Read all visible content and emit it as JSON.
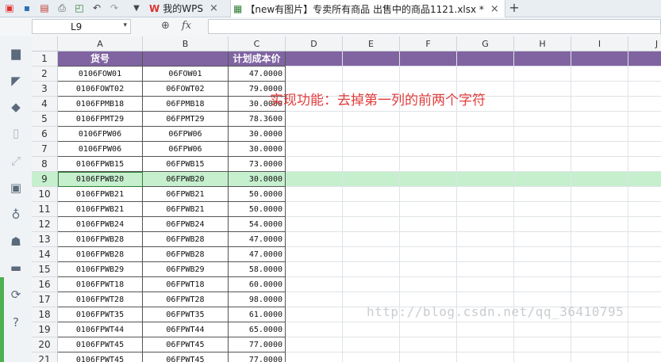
{
  "tabs": [
    {
      "label": "我的WPS",
      "close": "×"
    },
    {
      "label": "【new有图片】专卖所有商品 出售中的商品1121.xlsx *",
      "close": "×"
    }
  ],
  "new_tab": "+",
  "toolbar_icons": [
    "wps-logo-icon",
    "save-icon",
    "print-preview-icon",
    "print-icon",
    "preview-icon",
    "undo-icon",
    "redo-icon",
    "dropdown-icon"
  ],
  "namebox": {
    "value": "L9",
    "arrow": "▾"
  },
  "formula_bar": {
    "zoom_icon": "⊕",
    "fx": "fx",
    "value": ""
  },
  "columns": [
    "A",
    "B",
    "C",
    "D",
    "E",
    "F",
    "G",
    "H",
    "I",
    "J"
  ],
  "header_row": {
    "a": "货号",
    "b": "",
    "c": "计划成本价"
  },
  "rows": [
    {
      "n": "2",
      "a": "0106FOW01",
      "b": "06FOW01",
      "c": "47.0000"
    },
    {
      "n": "3",
      "a": "0106FOWT02",
      "b": "06FOWT02",
      "c": "79.0000"
    },
    {
      "n": "4",
      "a": "0106FPMB18",
      "b": "06FPMB18",
      "c": "30.0000"
    },
    {
      "n": "5",
      "a": "0106FPMT29",
      "b": "06FPMT29",
      "c": "78.3600"
    },
    {
      "n": "6",
      "a": "0106FPW06",
      "b": "06FPW06",
      "c": "30.0000"
    },
    {
      "n": "7",
      "a": "0106FPW06",
      "b": "06FPW06",
      "c": "30.0000"
    },
    {
      "n": "8",
      "a": "0106FPWB15",
      "b": "06FPWB15",
      "c": "73.0000"
    },
    {
      "n": "9",
      "a": "0106FPWB20",
      "b": "06FPWB20",
      "c": "30.0000"
    },
    {
      "n": "10",
      "a": "0106FPWB21",
      "b": "06FPWB21",
      "c": "50.0000"
    },
    {
      "n": "11",
      "a": "0106FPWB21",
      "b": "06FPWB21",
      "c": "50.0000"
    },
    {
      "n": "12",
      "a": "0106FPWB24",
      "b": "06FPWB24",
      "c": "54.0000"
    },
    {
      "n": "13",
      "a": "0106FPWB28",
      "b": "06FPWB28",
      "c": "47.0000"
    },
    {
      "n": "14",
      "a": "0106FPWB28",
      "b": "06FPWB28",
      "c": "47.0000"
    },
    {
      "n": "15",
      "a": "0106FPWB29",
      "b": "06FPWB29",
      "c": "58.0000"
    },
    {
      "n": "16",
      "a": "0106FPWT18",
      "b": "06FPWT18",
      "c": "60.0000"
    },
    {
      "n": "17",
      "a": "0106FPWT28",
      "b": "06FPWT28",
      "c": "98.0000"
    },
    {
      "n": "18",
      "a": "0106FPWT35",
      "b": "06FPWT35",
      "c": "61.0000"
    },
    {
      "n": "19",
      "a": "0106FPWT44",
      "b": "06FPWT44",
      "c": "65.0000"
    },
    {
      "n": "20",
      "a": "0106FPWT45",
      "b": "06FPWT45",
      "c": "77.0000"
    },
    {
      "n": "21",
      "a": "0106FPWT45",
      "b": "06FPWT45",
      "c": "77.0000"
    }
  ],
  "header_row_number": "1",
  "selected_row": "9",
  "note": "实现功能：去掉第一列的前两个字符",
  "watermark": "http://blog.csdn.net/qq_36410795",
  "colors": {
    "header_bg": "#8064a2",
    "selection_bg": "#c6efce",
    "note": "#e23c3c",
    "accent": "#4caf50"
  }
}
